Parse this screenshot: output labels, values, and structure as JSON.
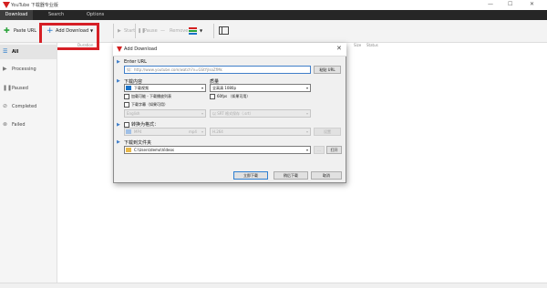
{
  "app": {
    "title": "YouTube 下载器专业版",
    "window_controls": [
      "—",
      "☐",
      "✕"
    ]
  },
  "menu": [
    "Download",
    "Search",
    "Options"
  ],
  "toolbar": {
    "paste_url": "Paste URL",
    "add_download": "Add Download",
    "start": "Start",
    "pause": "Pause",
    "remove": "Remove"
  },
  "list_header": {
    "col1": "Duration",
    "col2": "Size",
    "col3": "Status"
  },
  "sidebar": [
    {
      "icon": "list-icon",
      "label": "All"
    },
    {
      "icon": "play-icon",
      "label": "Processing"
    },
    {
      "icon": "pause-icon",
      "label": "Paused"
    },
    {
      "icon": "check-icon",
      "label": "Completed"
    },
    {
      "icon": "error-icon",
      "label": "Failed"
    }
  ],
  "dialog": {
    "title": "Add Download",
    "enter_url_label": "Enter URL",
    "url_placeholder": "如：http://www.youtube.com/watch?v=GStYjIsoZfMk",
    "paste_url_btn": "粘贴 URL",
    "content_label": "下载内容",
    "content_value": "下载视频",
    "quality_label": "质量",
    "quality_value": "全高清 1080p",
    "add_to_list": "加载可能 - 下载播放列表",
    "fps60": "60fps （如果可用）",
    "subtitles": "下载字幕（如果可用）",
    "subtitle_lang": "English",
    "subtitle_format": "以 SRT 格式保存（.srt）",
    "convert_label": "转换为格式：",
    "format_value": "MP4",
    "format_ext": "mp4",
    "codec_value": "H.264",
    "codec_btn": "设置",
    "folder_label": "下载到文件夹",
    "folder_value": "C:\\Users\\demo\\Videos",
    "browse_btn": "...",
    "open_btn": "打开",
    "download_now": "立即下载",
    "add_later": "稍后下载",
    "cancel": "取消"
  },
  "colors": {
    "accent_red": "#d61f26",
    "brand_red": "#d42020",
    "blue": "#3f7ec9",
    "menubar": "#262626"
  }
}
